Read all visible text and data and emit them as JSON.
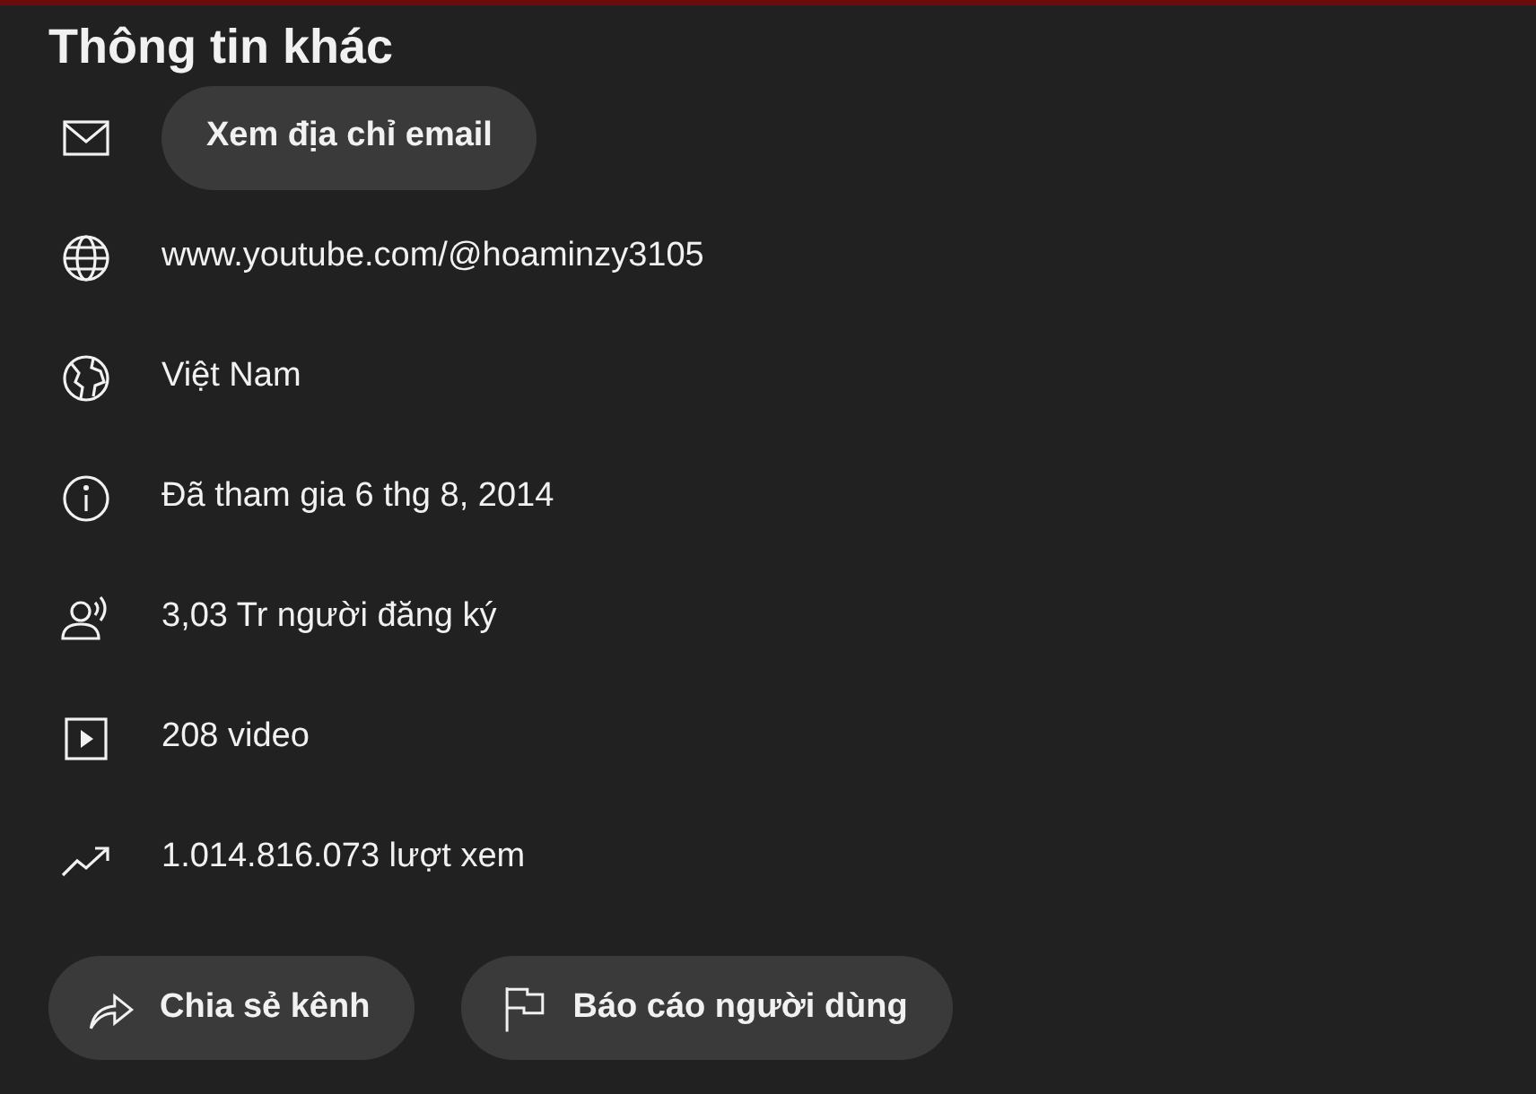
{
  "title": "Thông tin khác",
  "rows": [
    {
      "kind": "email",
      "button": "Xem địa chỉ email"
    },
    {
      "kind": "link",
      "text": "www.youtube.com/@hoaminzy3105"
    },
    {
      "kind": "country",
      "text": "Việt Nam"
    },
    {
      "kind": "joined",
      "text": "Đã tham gia 6 thg 8, 2014"
    },
    {
      "kind": "subscribers",
      "text": "3,03 Tr người đăng ký"
    },
    {
      "kind": "videos",
      "text": "208 video"
    },
    {
      "kind": "views",
      "text": "1.014.816.073 lượt xem"
    }
  ],
  "actions": [
    {
      "kind": "share",
      "label": "Chia sẻ kênh"
    },
    {
      "kind": "report",
      "label": "Báo cáo người dùng"
    }
  ]
}
